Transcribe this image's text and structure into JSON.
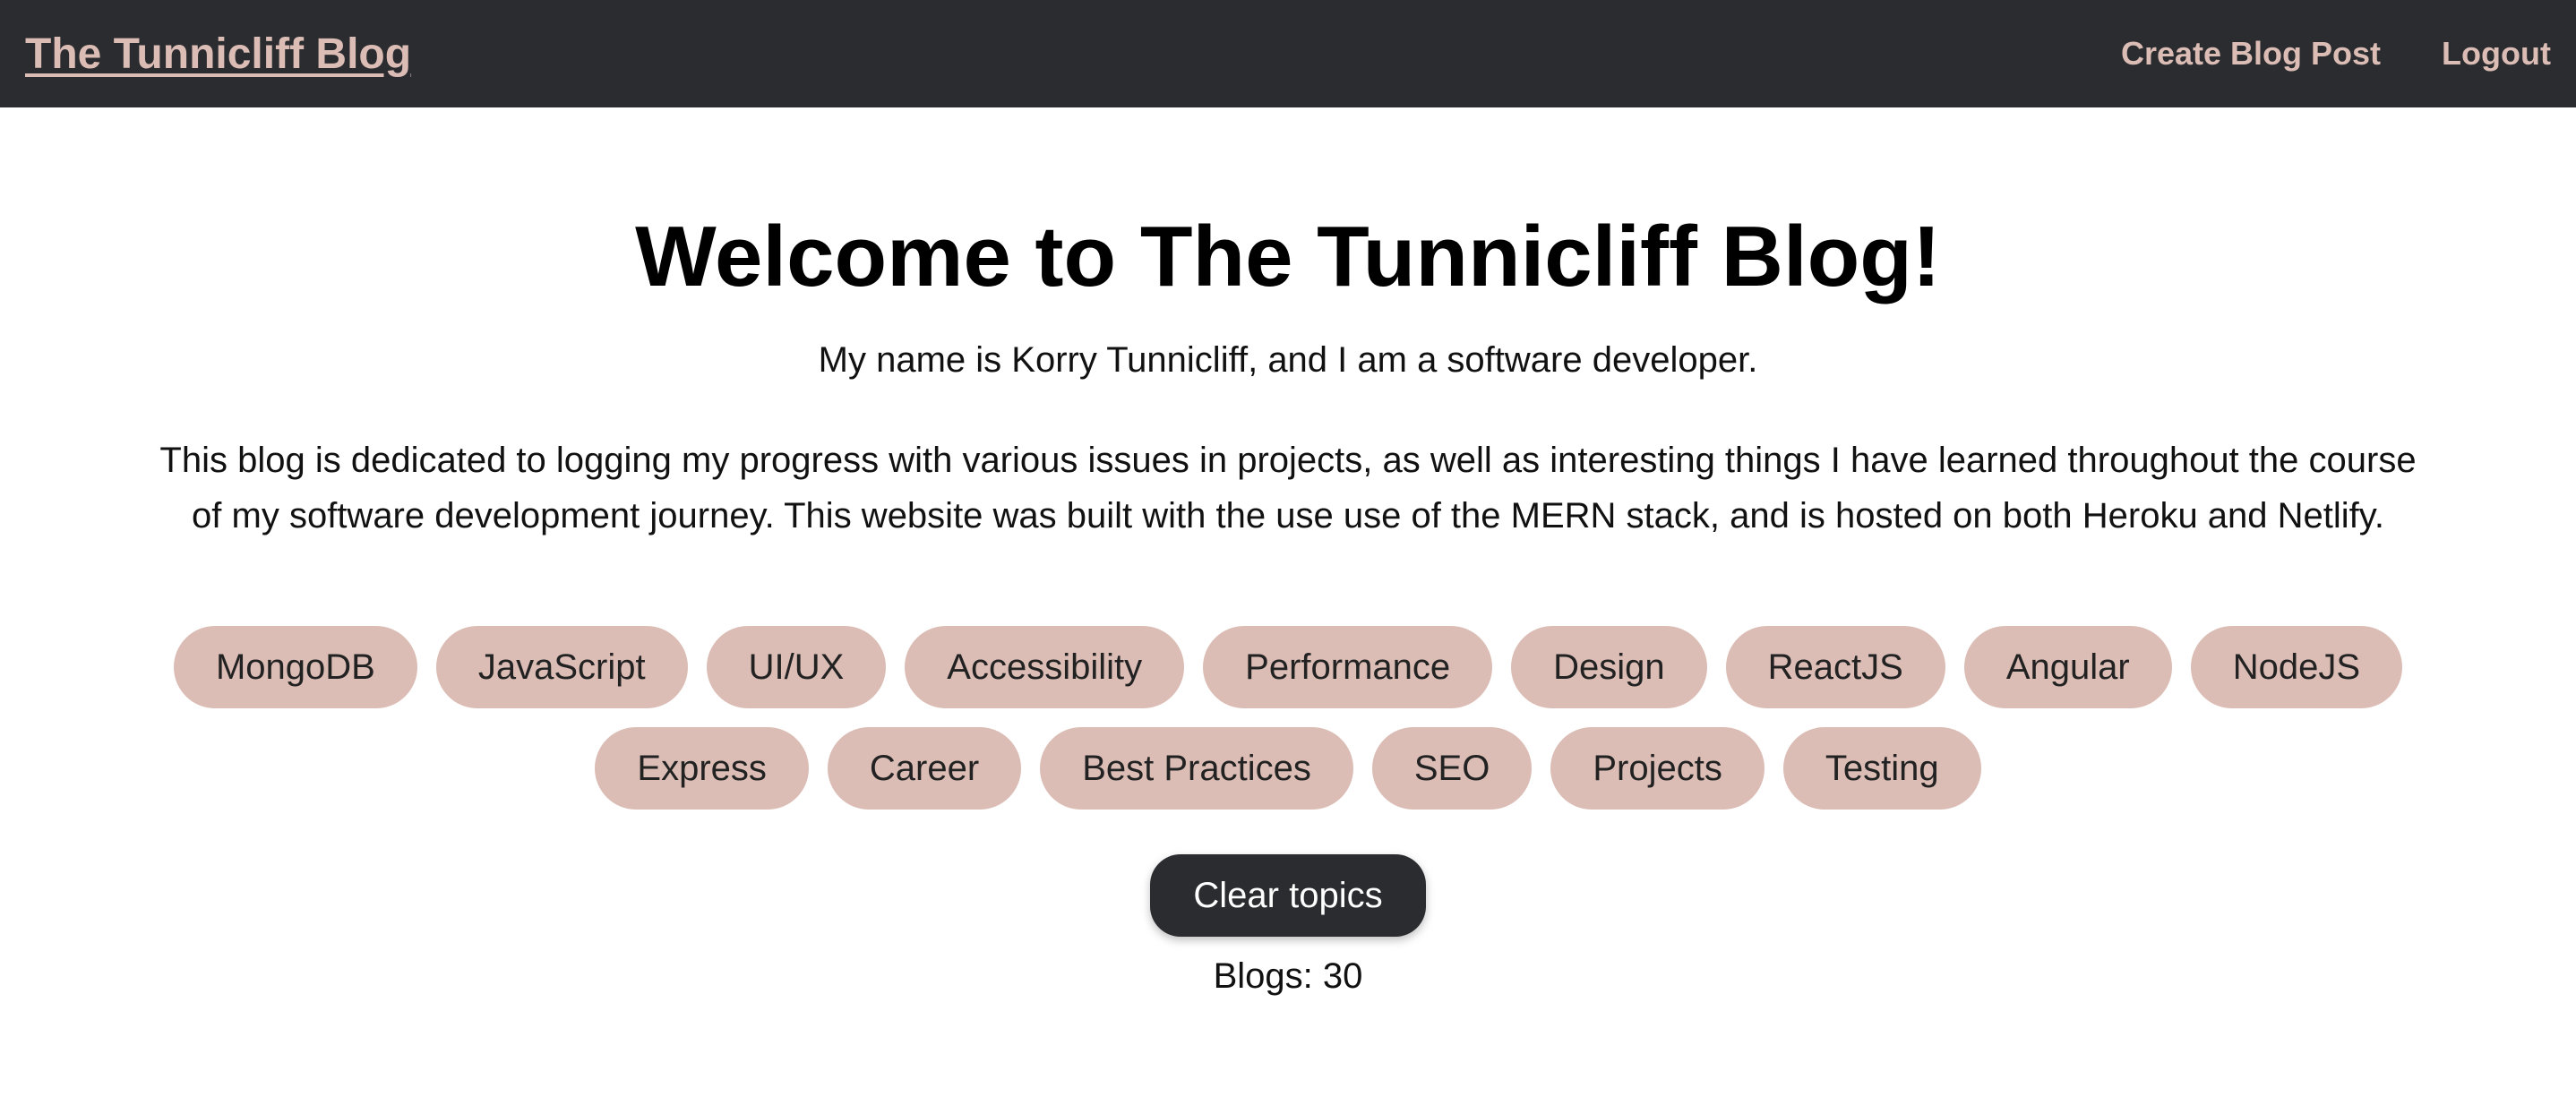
{
  "navbar": {
    "brand": "The Tunnicliff Blog",
    "links": {
      "create": "Create Blog Post",
      "logout": "Logout"
    }
  },
  "main": {
    "title": "Welcome to The Tunnicliff Blog!",
    "intro": "My name is Korry Tunnicliff, and I am a software developer.",
    "description": "This blog is dedicated to logging my progress with various issues in projects, as well as interesting things I have learned throughout the course of my software development journey. This website was built with the use use of the MERN stack, and is hosted on both Heroku and Netlify."
  },
  "topics": [
    "MongoDB",
    "JavaScript",
    "UI/UX",
    "Accessibility",
    "Performance",
    "Design",
    "ReactJS",
    "Angular",
    "NodeJS",
    "Express",
    "Career",
    "Best Practices",
    "SEO",
    "Projects",
    "Testing"
  ],
  "clear_button": "Clear topics",
  "blog_count": "Blogs: 30",
  "colors": {
    "navbar_bg": "#2b2c30",
    "accent": "#dbbdb5"
  }
}
